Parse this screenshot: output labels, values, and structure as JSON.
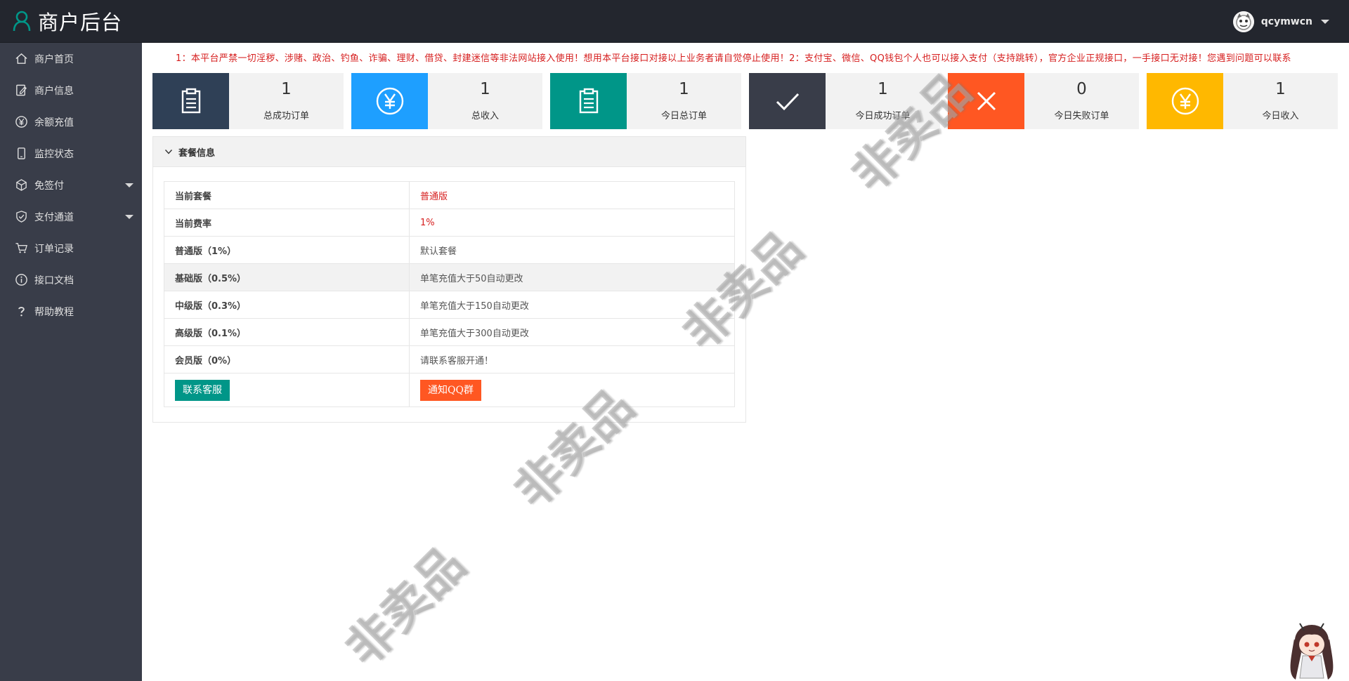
{
  "header": {
    "title": "商户后台",
    "username": "qcymwcn",
    "brand_icon": "user-outline-icon",
    "accent_color": "#009688"
  },
  "sidebar": {
    "items": [
      {
        "label": "商户首页",
        "icon": "home-icon"
      },
      {
        "label": "商户信息",
        "icon": "edit-document-icon"
      },
      {
        "label": "余额充值",
        "icon": "yen-circle-icon"
      },
      {
        "label": "监控状态",
        "icon": "mobile-icon"
      },
      {
        "label": "免签付",
        "icon": "cube-icon",
        "has_submenu": true
      },
      {
        "label": "支付通道",
        "icon": "shield-check-icon",
        "has_submenu": true
      },
      {
        "label": "订单记录",
        "icon": "cart-icon"
      },
      {
        "label": "接口文档",
        "icon": "info-icon"
      },
      {
        "label": "帮助教程",
        "icon": "question-icon"
      }
    ]
  },
  "notice": "1：本平台严禁一切淫秽、涉赌、政治、钓鱼、诈骗、理财、借贷、封建迷信等非法网站接入使用！想用本平台接口对接以上业务者请自觉停止使用！2：支付宝、微信、QQ钱包个人也可以接入支付（支持跳转），官方企业正规接口，一手接口无对接！您遇到问题可以联系",
  "stats": [
    {
      "value": "1",
      "label": "总成功订单",
      "icon": "clipboard-icon",
      "color": "#2f4056"
    },
    {
      "value": "1",
      "label": "总收入",
      "icon": "yen-circle-icon",
      "color": "#1e9fff"
    },
    {
      "value": "1",
      "label": "今日总订单",
      "icon": "clipboard-icon",
      "color": "#009688"
    },
    {
      "value": "1",
      "label": "今日成功订单",
      "icon": "check-icon",
      "color": "#393d49"
    },
    {
      "value": "0",
      "label": "今日失败订单",
      "icon": "close-icon",
      "color": "#ff5722"
    },
    {
      "value": "1",
      "label": "今日收入",
      "icon": "yen-circle-icon",
      "color": "#ffb800"
    }
  ],
  "package_panel": {
    "title": "套餐信息",
    "rows": [
      {
        "key": "当前套餐",
        "value": "普通版"
      },
      {
        "key": "当前费率",
        "value": "1%"
      },
      {
        "key": "普通版（1%）",
        "value": "默认套餐"
      },
      {
        "key": "基础版（0.5%）",
        "value": "单笔充值大于50自动更改"
      },
      {
        "key": "中级版（0.3%）",
        "value": "单笔充值大于150自动更改"
      },
      {
        "key": "高级版（0.1%）",
        "value": "单笔充值大于300自动更改"
      },
      {
        "key": "会员版（0%）",
        "value": "请联系客服开通！"
      }
    ],
    "contact_button": "联系客服",
    "qq_button": "通知QQ群"
  },
  "watermark": "非卖品"
}
